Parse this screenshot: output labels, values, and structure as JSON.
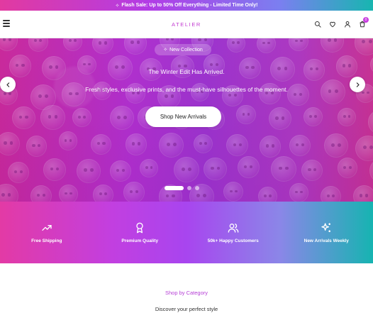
{
  "announcement": {
    "icon": "sparkle-icon",
    "text": "Flash Sale: Up to 50% Off Everything - Limited Time Only!"
  },
  "header": {
    "logo": "ATELIER",
    "icons": [
      "search-icon",
      "heart-icon",
      "user-icon",
      "cart-icon"
    ],
    "cart_count": "0"
  },
  "hero": {
    "badge": "New Collection",
    "title": "The Winter Edit Has Arrived.",
    "subtitle": "Fresh styles, exclusive prints, and the must-have silhouettes of the moment.",
    "cta": "Shop New Arrivals",
    "slides_total": 3,
    "active_slide": 1
  },
  "features": [
    {
      "icon": "trending-up-icon",
      "label": "Free Shipping"
    },
    {
      "icon": "award-icon",
      "label": "Premium Quality"
    },
    {
      "icon": "users-icon",
      "label": "50k+ Happy Customers"
    },
    {
      "icon": "sparkles-icon",
      "label": "New Arrivals Weekly"
    }
  ],
  "categories": {
    "title": "Shop by Category",
    "subtitle": "Discover your perfect style"
  },
  "colors": {
    "accent": "#c23ad0",
    "gradient_start": "#e33aa5",
    "gradient_mid": "#a845ef",
    "gradient_end": "#16b4b1"
  }
}
